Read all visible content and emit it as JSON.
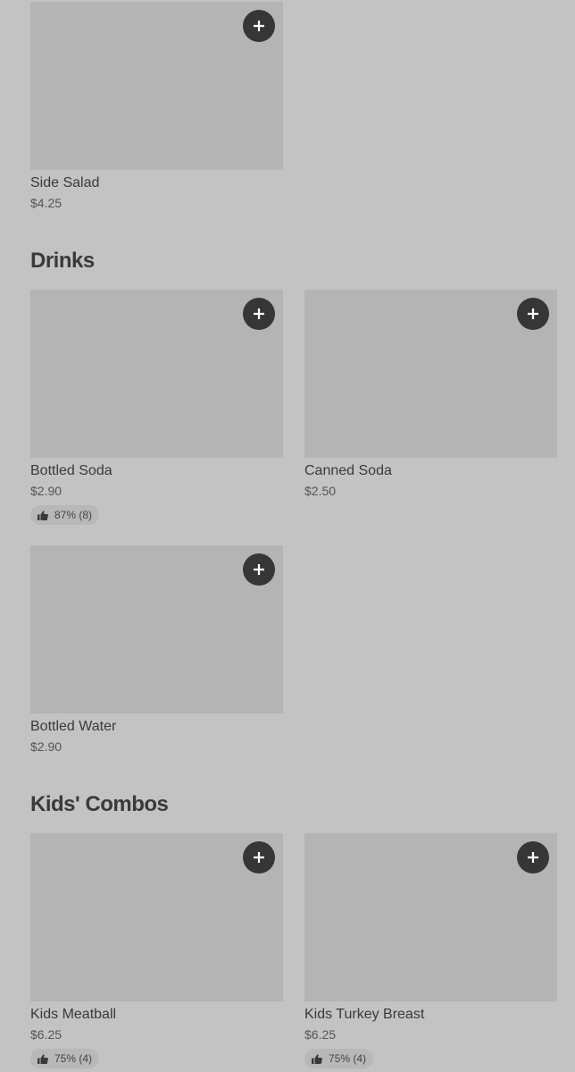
{
  "sections": [
    {
      "title": "",
      "items": [
        {
          "name": "Side Salad",
          "price": "$4.25"
        }
      ]
    },
    {
      "title": "Drinks",
      "items": [
        {
          "name": "Bottled Soda",
          "price": "$2.90",
          "rating": "87% (8)"
        },
        {
          "name": "Canned Soda",
          "price": "$2.50"
        },
        {
          "name": "Bottled Water",
          "price": "$2.90"
        }
      ]
    },
    {
      "title": "Kids' Combos",
      "items": [
        {
          "name": "Kids Meatball",
          "price": "$6.25",
          "rating": "75% (4)"
        },
        {
          "name": "Kids Turkey Breast",
          "price": "$6.25",
          "rating": "75% (4)"
        }
      ]
    }
  ],
  "icons": {
    "add": "plus-icon",
    "rating": "thumbs-up-icon"
  },
  "colors": {
    "background": "#c3c3c3",
    "thumbnail": "#b4b4b4",
    "add_button": "#363636",
    "text": "#3a3a3a"
  }
}
